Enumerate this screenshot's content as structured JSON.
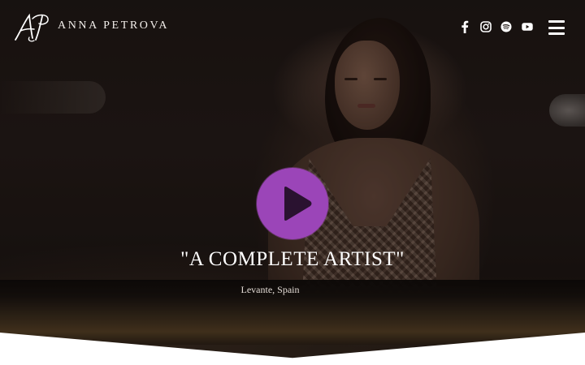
{
  "header": {
    "logo_monogram": "AP",
    "site_name": "ANNA PETROVA",
    "social_icons": [
      "facebook-icon",
      "instagram-icon",
      "spotify-icon",
      "youtube-icon"
    ],
    "menu_icon": "hamburger-menu-icon"
  },
  "hero": {
    "play_icon": "play-icon",
    "quote": "\"A COMPLETE ARTIST\"",
    "source": "Levante, Spain"
  },
  "colors": {
    "accent": "#9b45b8",
    "text": "#ffffff",
    "background": "#1d1714",
    "page": "#ffffff"
  }
}
